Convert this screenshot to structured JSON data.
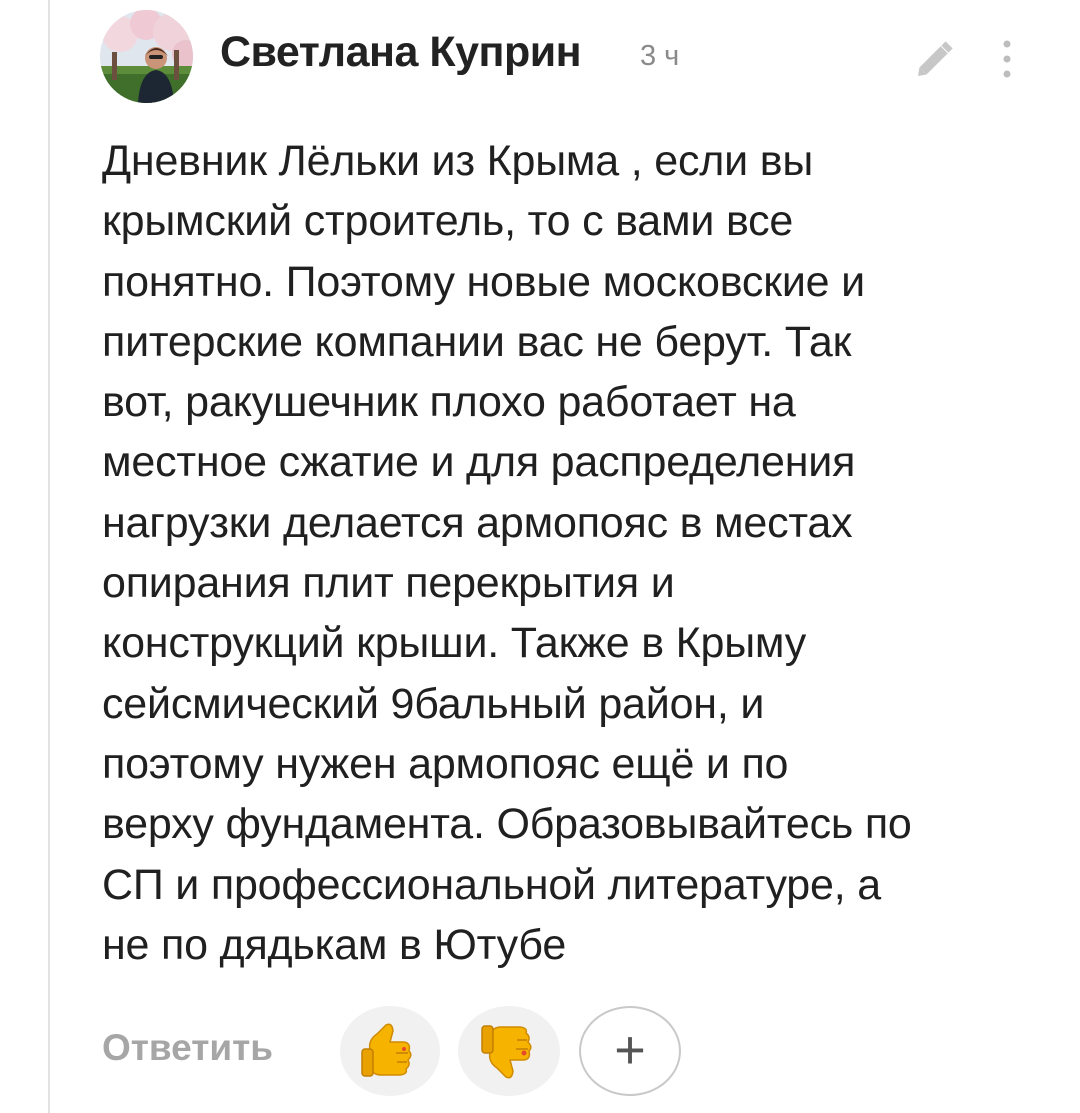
{
  "comment": {
    "author": "Светлана Куприн",
    "time": "3 ч",
    "text_lines": [
      "Дневник Лёльки из Крыма , если вы",
      "крымский строитель, то с вами все",
      "понятно. Поэтому новые московские и",
      "питерские компании вас не берут. Так",
      "вот, ракушечник плохо работает на",
      "местное сжатие и для распределения",
      "нагрузки делается армопояс в местах",
      "опирания плит перекрытия и",
      "конструкций крыши. Также в Крыму",
      "сейсмический 9бальный район, и",
      "поэтому нужен армопояс ещё и по",
      "верху фундамента. Образовывайтесь по",
      "СП и профессиональной литературе, а",
      "не по дядькам в Ютубе"
    ]
  },
  "header_actions": {
    "edit_icon": "pencil-icon",
    "more_icon": "vertical-dots-icon"
  },
  "actions": {
    "reply_label": "Ответить",
    "like_icon": "thumbs-up-icon",
    "dislike_icon": "thumbs-down-icon",
    "add_label": "+"
  },
  "colors": {
    "text": "#202020",
    "muted": "#8a8a8a",
    "reply": "#a6a6a6",
    "button_bg": "#f1f1f1",
    "emoji_yellow": "#f6b400",
    "emoji_red": "#e54a2b"
  }
}
